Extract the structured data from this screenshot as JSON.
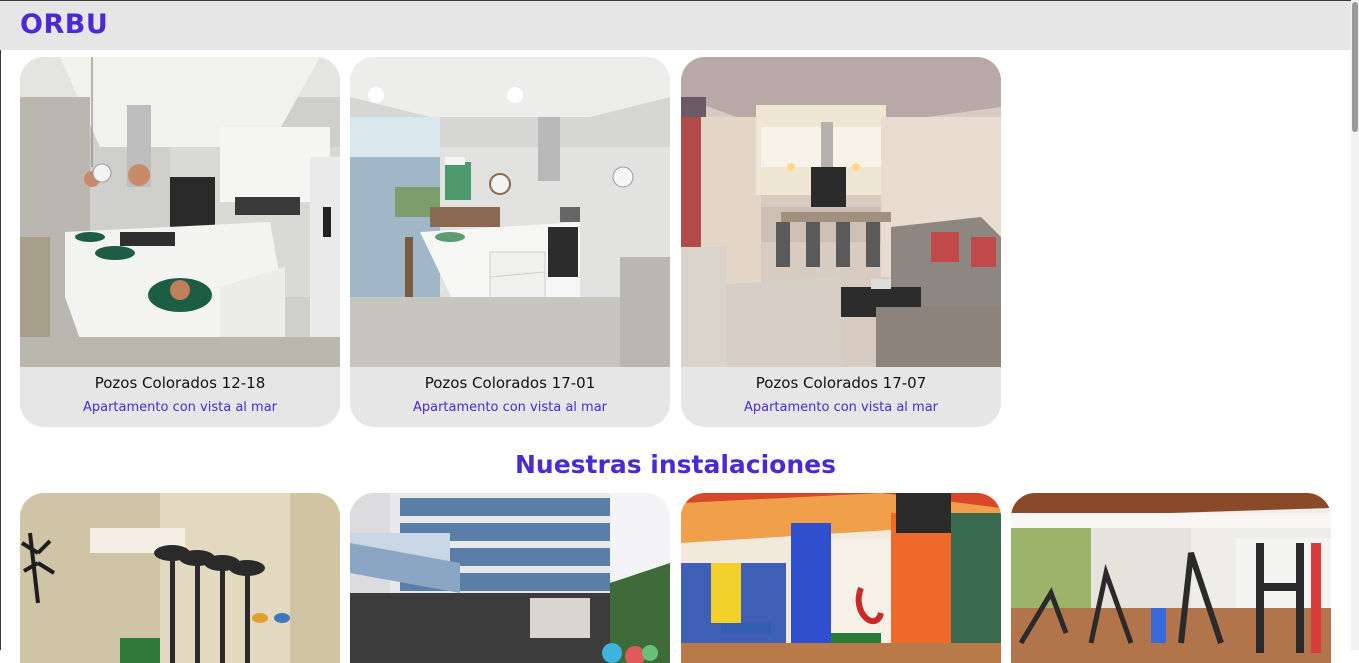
{
  "header": {
    "brand": "ORBU"
  },
  "listings": [
    {
      "title": "Pozos Colorados 12-18",
      "subtitle": "Apartamento con vista al mar",
      "photo": "kitchen-island-photo"
    },
    {
      "title": "Pozos Colorados 17-01",
      "subtitle": "Apartamento con vista al mar",
      "photo": "kitchen-sea-view-photo"
    },
    {
      "title": "Pozos Colorados 17-07",
      "subtitle": "Apartamento con vista al mar",
      "photo": "living-dining-photo"
    }
  ],
  "facilities": {
    "title": "Nuestras instalaciones",
    "photos": [
      "lobby-photo",
      "building-pool-photo",
      "game-room-photo",
      "gym-photo"
    ]
  },
  "colors": {
    "accent": "#4b2ad3",
    "card_bg": "#e6e6e6",
    "header_bg": "#e6e6e6"
  }
}
